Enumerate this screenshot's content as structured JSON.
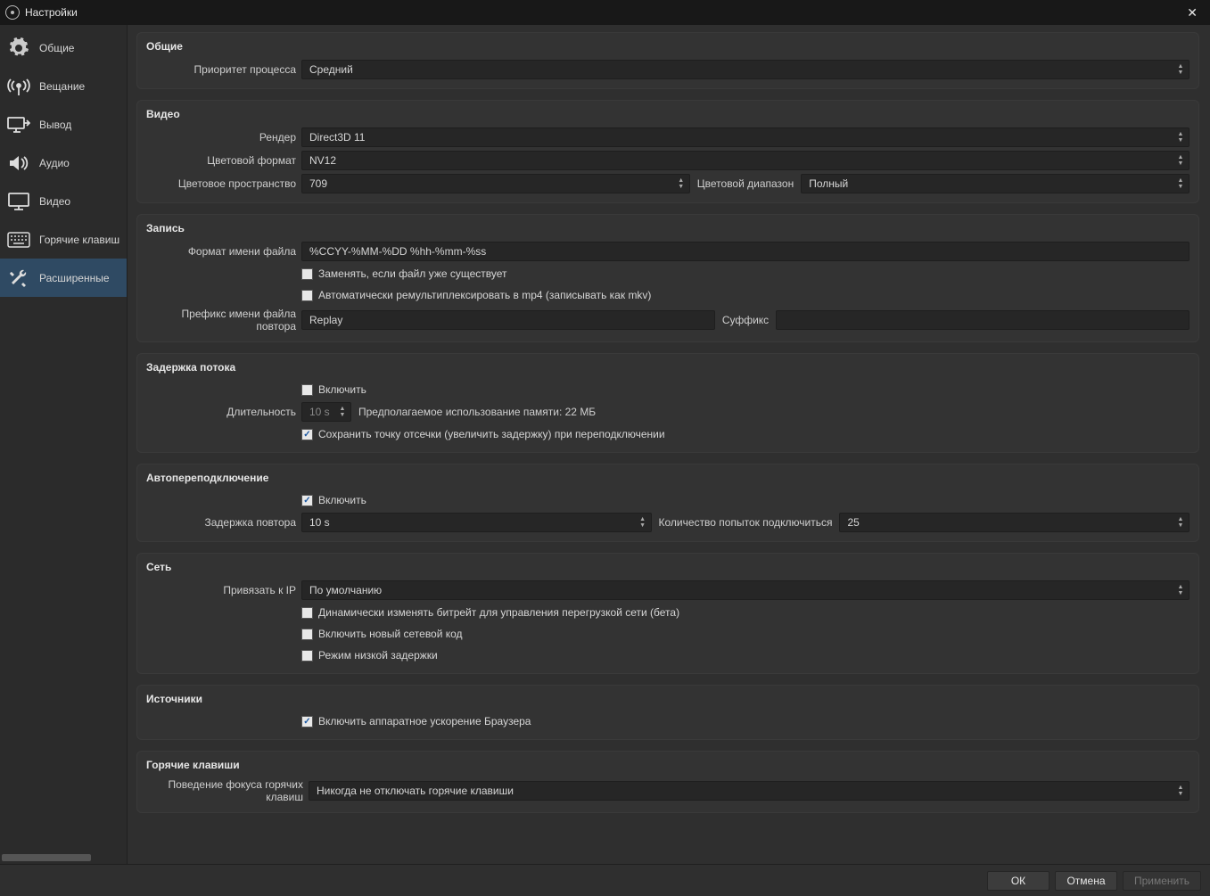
{
  "window": {
    "title": "Настройки"
  },
  "sidebar": {
    "items": [
      {
        "label": "Общие"
      },
      {
        "label": "Вещание"
      },
      {
        "label": "Вывод"
      },
      {
        "label": "Аудио"
      },
      {
        "label": "Видео"
      },
      {
        "label": "Горячие клавиш"
      },
      {
        "label": "Расширенные"
      }
    ]
  },
  "general": {
    "title": "Общие",
    "priority_label": "Приоритет процесса",
    "priority_value": "Средний"
  },
  "video": {
    "title": "Видео",
    "renderer_label": "Рендер",
    "renderer_value": "Direct3D 11",
    "color_format_label": "Цветовой формат",
    "color_format_value": "NV12",
    "color_space_label": "Цветовое пространство",
    "color_space_value": "709",
    "color_range_label": "Цветовой диапазон",
    "color_range_value": "Полный"
  },
  "recording": {
    "title": "Запись",
    "filename_label": "Формат имени файла",
    "filename_value": "%CCYY-%MM-%DD %hh-%mm-%ss",
    "overwrite_label": "Заменять, если файл уже существует",
    "remux_label": "Автоматически ремультиплексировать в mp4 (записывать как mkv)",
    "replay_prefix_label": "Префикс имени файла повтора",
    "replay_prefix_value": "Replay",
    "suffix_label": "Суффикс",
    "suffix_value": ""
  },
  "delay": {
    "title": "Задержка потока",
    "enable_label": "Включить",
    "duration_label": "Длительность",
    "duration_value": "10 s",
    "memory_hint": "Предполагаемое использование памяти: 22 МБ",
    "preserve_label": "Сохранить точку отсечки (увеличить задержку) при переподключении"
  },
  "reconnect": {
    "title": "Автопереподключение",
    "enable_label": "Включить",
    "retry_delay_label": "Задержка повтора",
    "retry_delay_value": "10 s",
    "max_retries_label": "Количество попыток подключиться",
    "max_retries_value": "25"
  },
  "network": {
    "title": "Сеть",
    "bind_label": "Привязать к IP",
    "bind_value": "По умолчанию",
    "dyn_bitrate_label": "Динамически изменять битрейт для управления перегрузкой сети (бета)",
    "new_netcode_label": "Включить новый сетевой код",
    "low_latency_label": "Режим низкой задержки"
  },
  "sources": {
    "title": "Источники",
    "browser_hw_label": "Включить аппаратное ускорение Браузера"
  },
  "hotkeys": {
    "title": "Горячие клавиши",
    "focus_label": "Поведение фокуса горячих клавиш",
    "focus_value": "Никогда не отключать горячие клавиши"
  },
  "footer": {
    "ok": "ОК",
    "cancel": "Отмена",
    "apply": "Применить"
  }
}
